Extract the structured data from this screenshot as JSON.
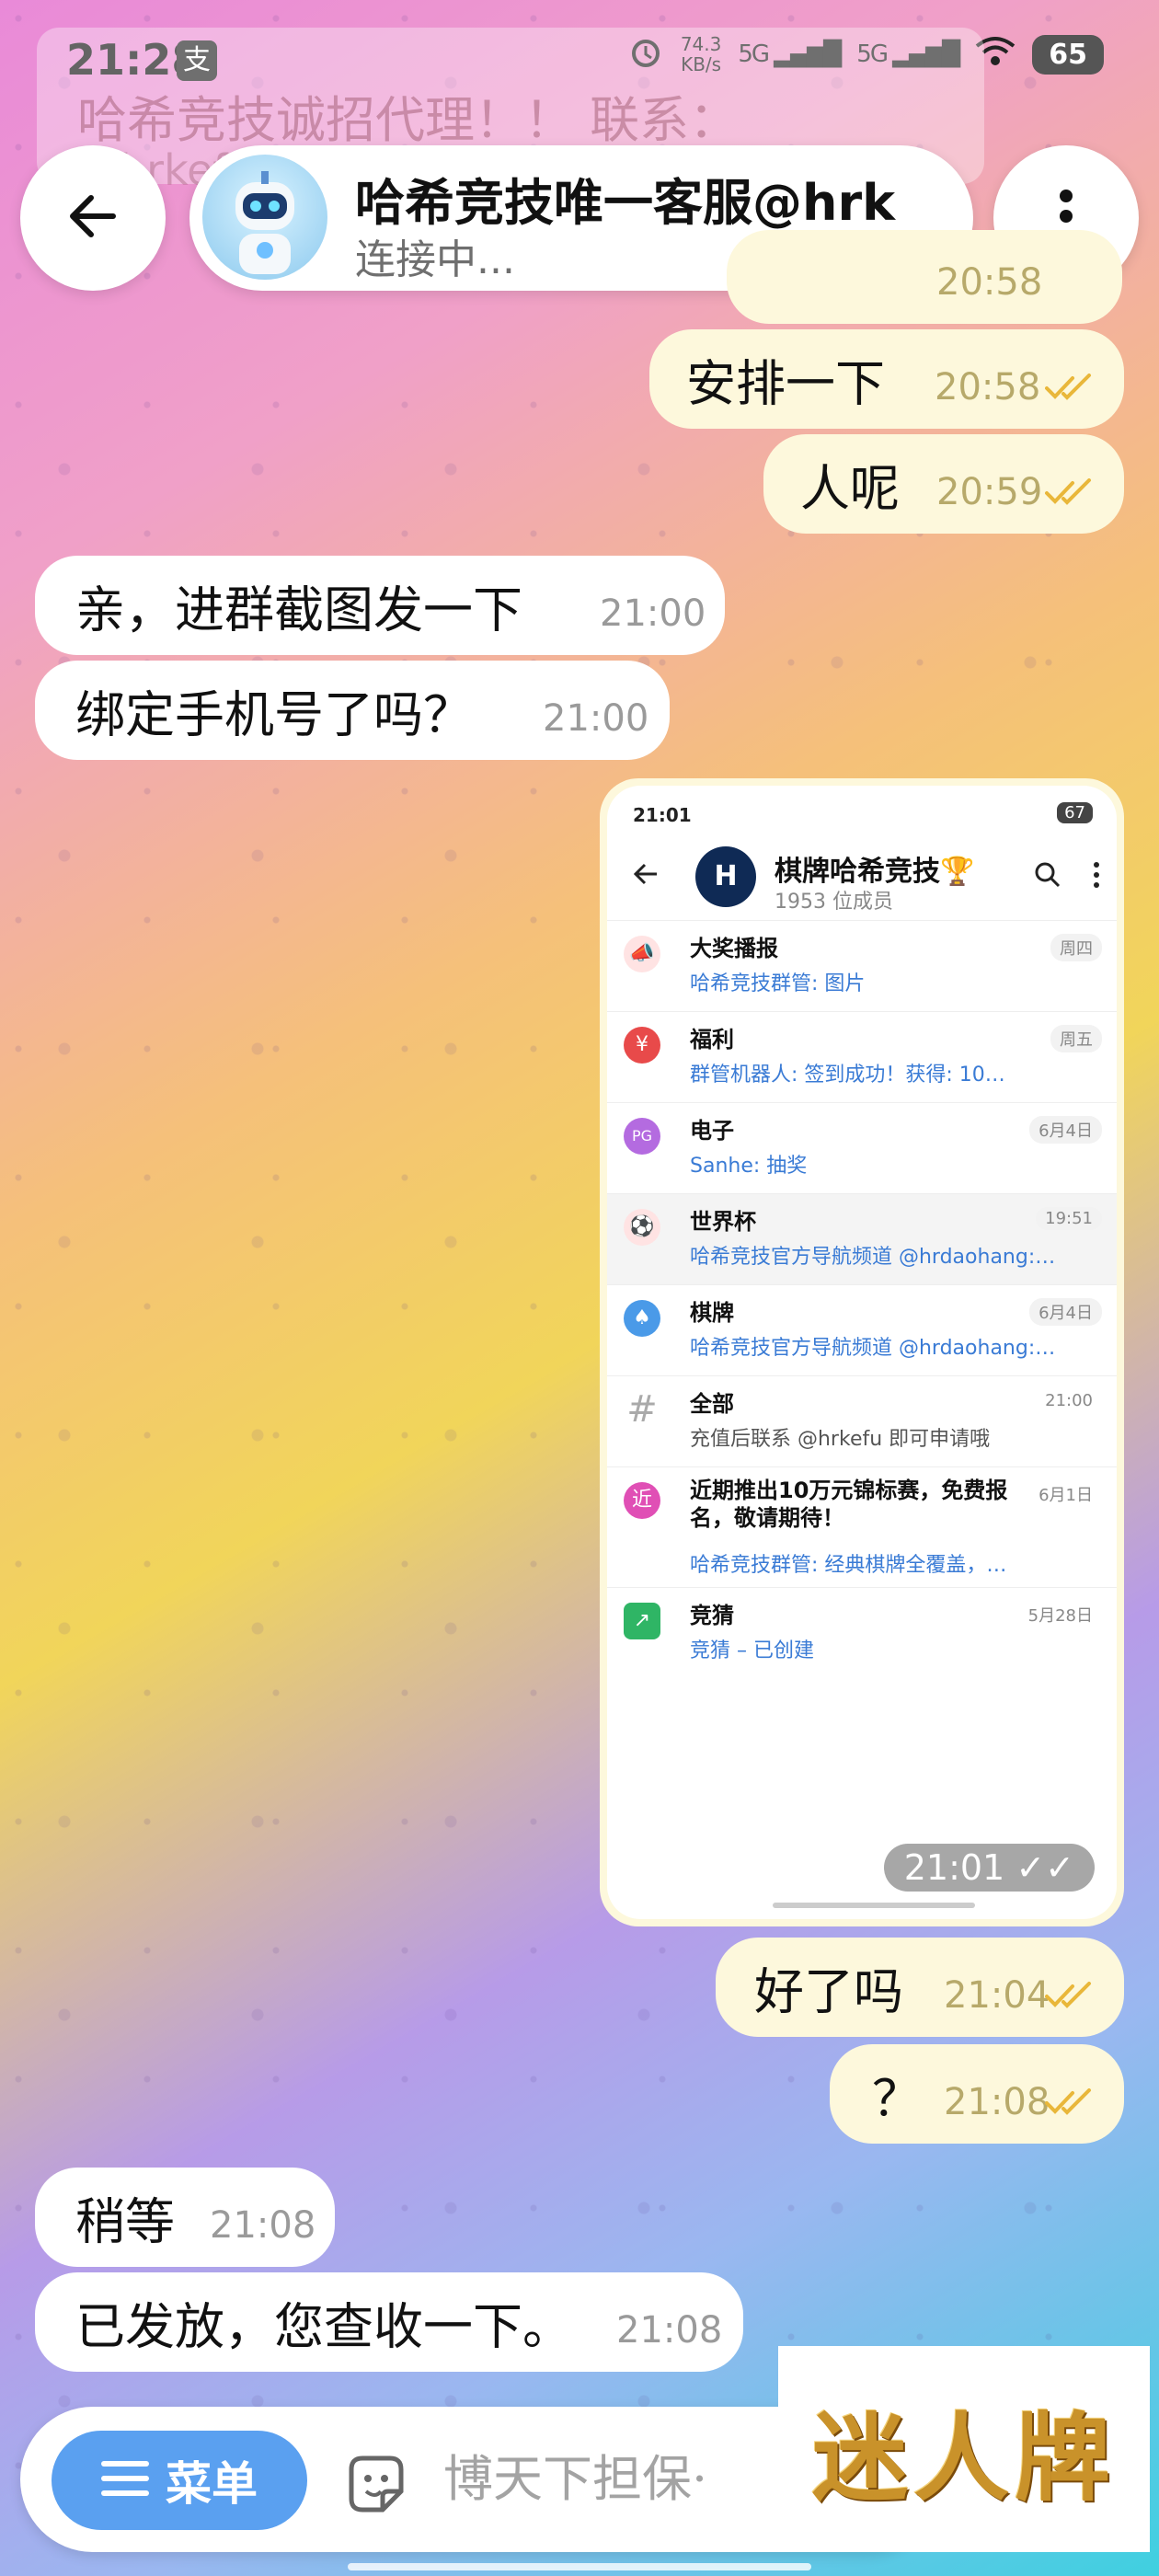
{
  "status_bar": {
    "time": "21:28",
    "pay_glyph": "支",
    "net_speed_value": "74.3",
    "net_speed_unit": "KB/s",
    "signal1": "5G",
    "signal2": "5G",
    "battery": "65"
  },
  "pinned": {
    "text": "哈希竞技诚招代理！！ 联系：",
    "sub": "@hrkefu"
  },
  "header": {
    "title": "哈希竞技唯一客服@hrk",
    "status": "连接中..."
  },
  "messages": [
    {
      "id": "m0",
      "text": "",
      "time": "20:58",
      "dir": "out"
    },
    {
      "id": "m1",
      "text": "安排一下",
      "time": "20:58",
      "dir": "out"
    },
    {
      "id": "m2",
      "text": "人呢",
      "time": "20:59",
      "dir": "out"
    },
    {
      "id": "m3",
      "text": "亲，进群截图发一下",
      "time": "21:00",
      "dir": "in"
    },
    {
      "id": "m4",
      "text": "绑定手机号了吗？",
      "time": "21:00",
      "dir": "in"
    },
    {
      "id": "m5",
      "text": "好了吗",
      "time": "21:04",
      "dir": "out"
    },
    {
      "id": "m6",
      "text": "？",
      "time": "21:08",
      "dir": "out"
    },
    {
      "id": "m7",
      "text": "稍等",
      "time": "21:08",
      "dir": "in"
    },
    {
      "id": "m8",
      "text": "已发放，您查收一下。",
      "time": "21:08",
      "dir": "in"
    }
  ],
  "image_message": {
    "time": "21:01",
    "screenshot": {
      "time": "21:01",
      "battery": "67",
      "group_title": "棋牌哈希竞技🏆",
      "members": "1953 位成员",
      "topics": [
        {
          "name": "大奖播报",
          "date": "周四",
          "preview": "哈希竞技群管: 图片",
          "icon": "📣",
          "color": "#ffe3e3"
        },
        {
          "name": "福利",
          "date": "周五",
          "preview": "群管机器人: 签到成功！获得: 10…",
          "icon": "¥",
          "color": "#e84a4a"
        },
        {
          "name": "电子",
          "date": "6月4日",
          "preview": "Sanhe: 抽奖",
          "icon": "PG",
          "color": "#b46be0"
        },
        {
          "name": "世界杯",
          "date": "19:51",
          "preview": "哈希竞技官方导航频道 @hrdaohang:…",
          "icon": "⚽",
          "color": "#ffe3e3"
        },
        {
          "name": "棋牌",
          "date": "6月4日",
          "preview": "哈希竞技官方导航频道 @hrdaohang:…",
          "icon": "♠",
          "color": "#4a9ae8"
        },
        {
          "name": "全部",
          "date": "21:00",
          "preview": "充值后联系 @hrkefu 即可申请哦",
          "icon": "#",
          "color": "#dddddd"
        },
        {
          "name": "近期推出10万元锦标赛，免费报名，敬请期待！",
          "date": "6月1日",
          "preview": "哈希竞技群管: 经典棋牌全覆盖，…",
          "icon": "近",
          "color": "#e04fb5"
        },
        {
          "name": "竞猜",
          "date": "5月28日",
          "preview": "竞猜 – 已创建",
          "icon": "↗",
          "color": "#2fb565"
        }
      ]
    }
  },
  "input": {
    "menu_label": "菜单",
    "placeholder": "博天下担保·"
  },
  "logo": {
    "text": "迷人牌"
  },
  "colors": {
    "accent": "#5aa0f0",
    "out_bubble": "#fdf8dc",
    "in_bubble": "#ffffff",
    "tick": "#e9b73a"
  },
  "icons": [
    "back-arrow-icon",
    "more-vert-icon",
    "menu-icon",
    "sticker-icon",
    "double-check-icon"
  ]
}
